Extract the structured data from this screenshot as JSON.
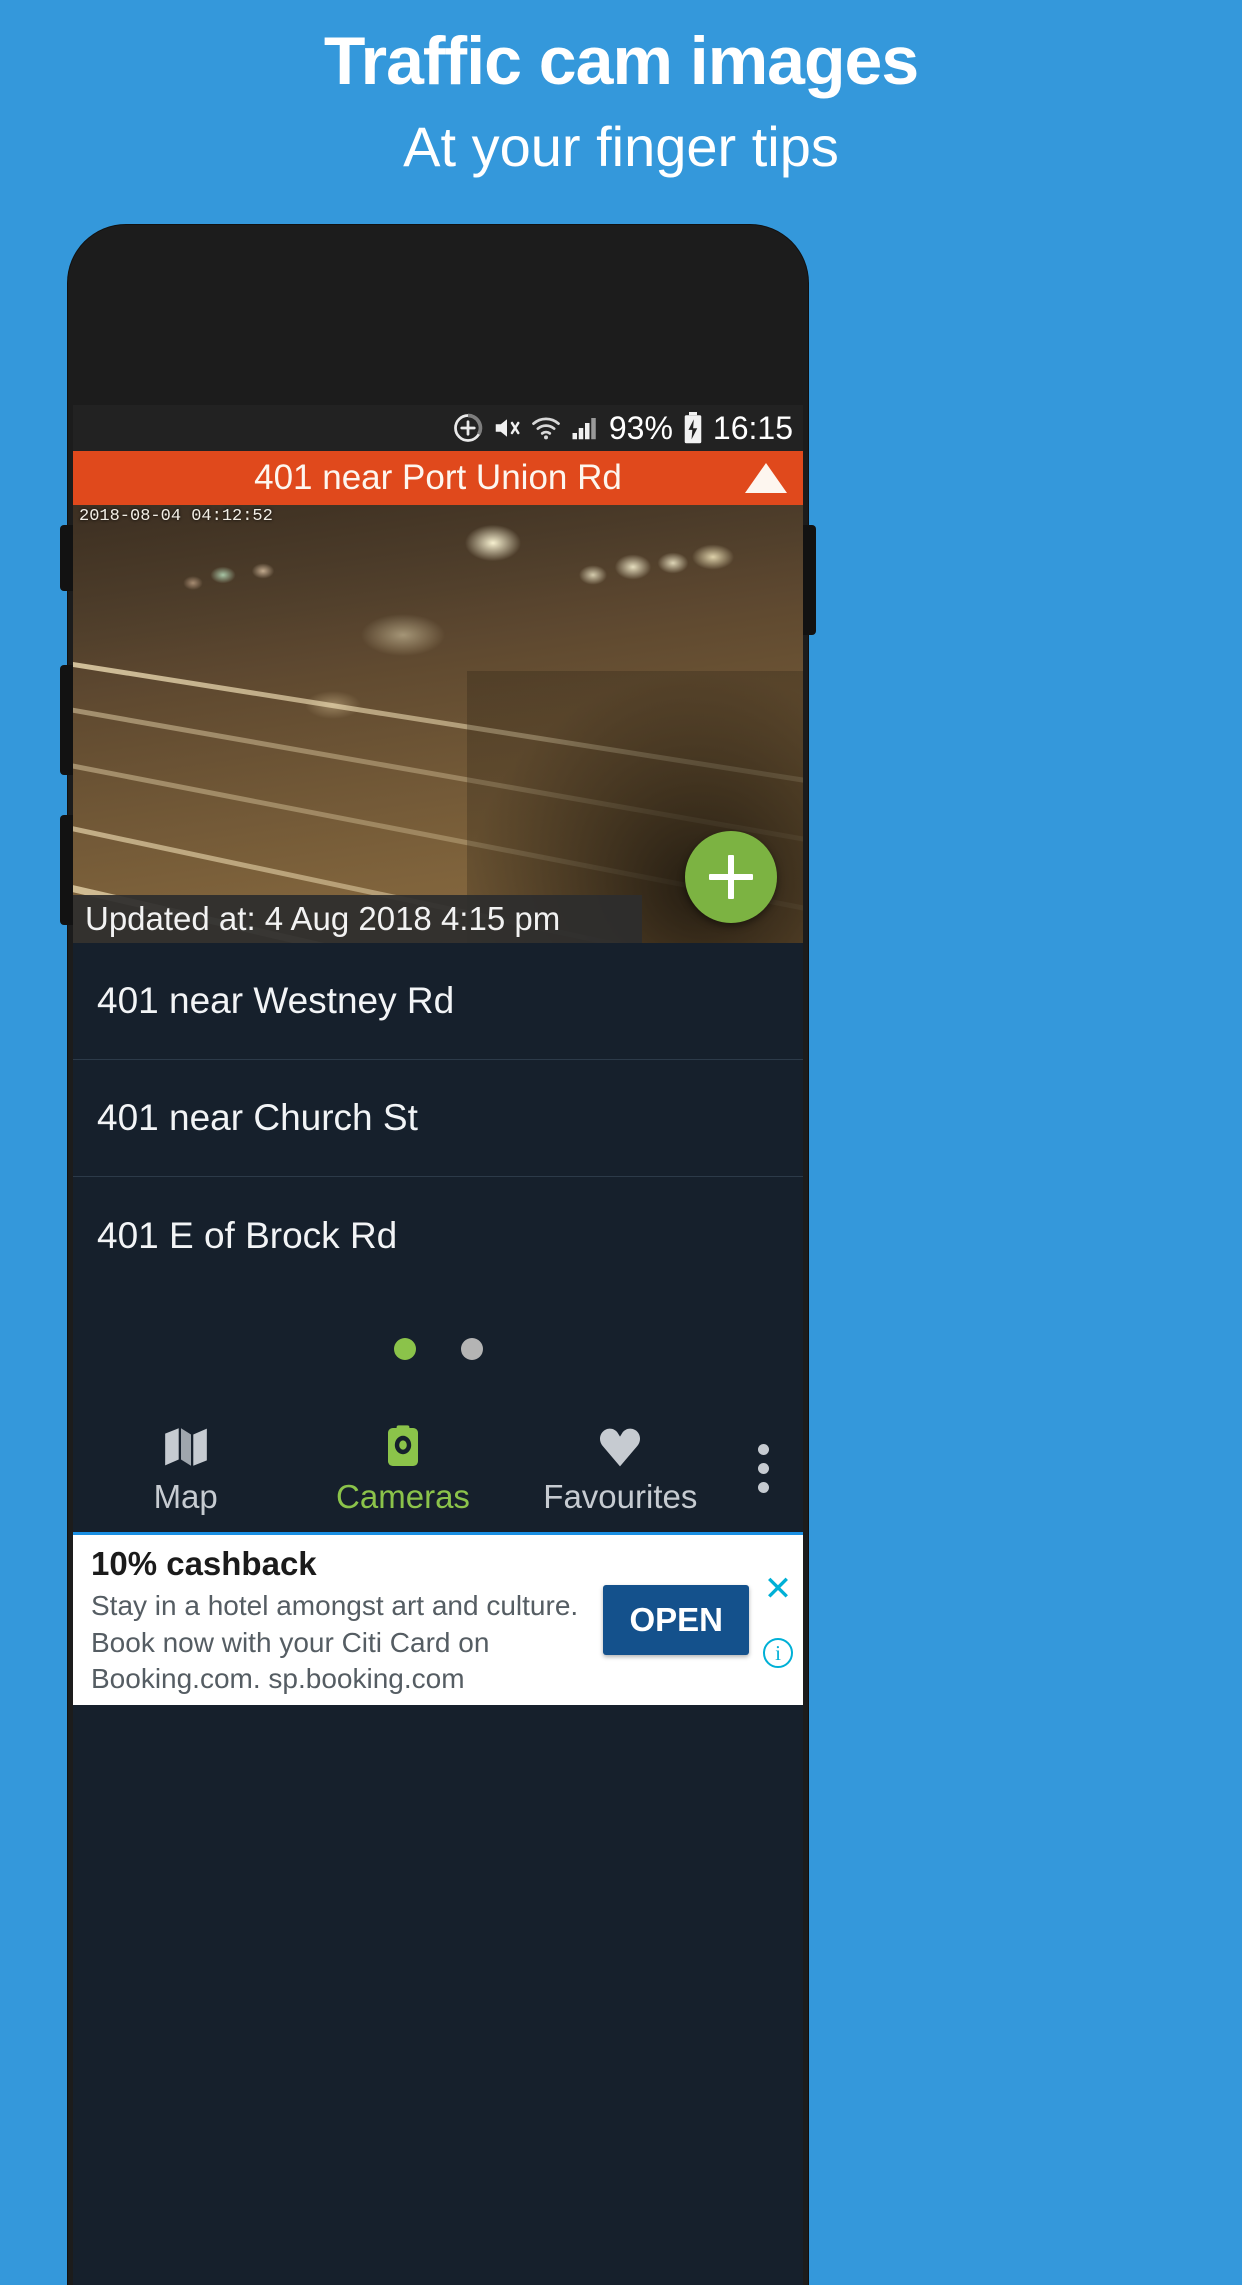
{
  "promo": {
    "title": "Traffic cam images",
    "subtitle": "At your finger tips"
  },
  "statusbar": {
    "battery_percent": "93%",
    "time": "16:15",
    "icons": [
      "do-not-disturb-icon",
      "volume-mute-icon",
      "wifi-icon",
      "cell-signal-icon",
      "battery-charging-icon"
    ]
  },
  "titlebar": {
    "title": "401 near Port Union Rd",
    "collapse_icon": "triangle-up-icon"
  },
  "camera": {
    "timestamp_overlay": "2018-08-04 04:12:52",
    "updated_label": "Updated at: 4 Aug 2018 4:15 pm",
    "fab_icon": "plus-icon"
  },
  "camera_list": [
    {
      "name": "401 near Westney Rd"
    },
    {
      "name": "401 near Church St"
    },
    {
      "name": "401 E of Brock Rd"
    }
  ],
  "pager": {
    "total": 2,
    "active_index": 0
  },
  "bottom_nav": {
    "items": [
      {
        "label": "Map",
        "icon": "map-icon",
        "active": false
      },
      {
        "label": "Cameras",
        "icon": "camera-icon",
        "active": true
      },
      {
        "label": "Favourites",
        "icon": "heart-icon",
        "active": false
      }
    ],
    "overflow_icon": "more-vertical-icon"
  },
  "ad": {
    "headline": "10% cashback",
    "body": "Stay in a hotel amongst art and culture. Book now with your Citi Card on Booking.com. sp.booking.com",
    "cta": "OPEN",
    "close_icon": "close-icon",
    "info_icon": "info-icon"
  },
  "colors": {
    "background": "#3498db",
    "titlebar": "#e0491c",
    "accent_green": "#8bc34a",
    "screen_bg": "#16202c",
    "ad_cta": "#14518c"
  }
}
